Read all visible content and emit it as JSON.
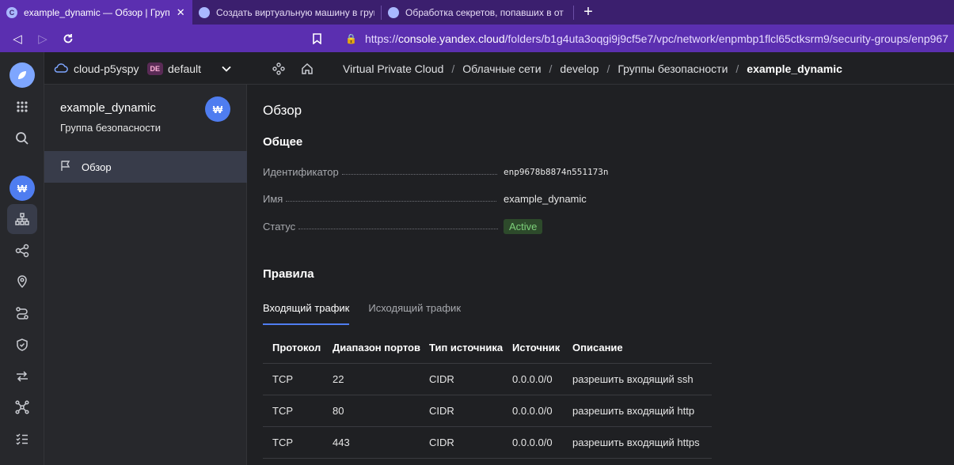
{
  "browser": {
    "tabs": [
      {
        "title": "example_dynamic — Обзор | Груп",
        "active": true
      },
      {
        "title": "Создать виртуальную машину в груп",
        "active": false
      },
      {
        "title": "Обработка секретов, попавших в от",
        "active": false
      }
    ],
    "url_prefix": "https://",
    "url_host": "console.yandex.cloud",
    "url_path": "/folders/b1g4uta3oqgi9j9cf5e7/vpc/network/enpmbp1flcl65ctksrm9/security-groups/enp967"
  },
  "header": {
    "cloud_name": "cloud-p5yspy",
    "folder_badge": "DE",
    "folder_name": "default",
    "breadcrumbs": [
      "Virtual Private Cloud",
      "Облачные сети",
      "develop",
      "Группы безопасности",
      "example_dynamic"
    ]
  },
  "panel": {
    "title": "example_dynamic",
    "subtitle": "Группа безопасности",
    "nav_item": "Обзор"
  },
  "main": {
    "title": "Обзор",
    "general_heading": "Общее",
    "props": {
      "id_label": "Идентификатор",
      "id_value": "enp9678b8874n551173n",
      "name_label": "Имя",
      "name_value": "example_dynamic",
      "status_label": "Статус",
      "status_value": "Active"
    },
    "rules_heading": "Правила",
    "tabs": [
      "Входящий трафик",
      "Исходящий трафик"
    ],
    "table": {
      "headers": [
        "Протокол",
        "Диапазон портов",
        "Тип источника",
        "Источник",
        "Описание"
      ],
      "rows": [
        [
          "TCP",
          "22",
          "CIDR",
          "0.0.0.0/0",
          "разрешить входящий ssh"
        ],
        [
          "TCP",
          "80",
          "CIDR",
          "0.0.0.0/0",
          "разрешить входящий http"
        ],
        [
          "TCP",
          "443",
          "CIDR",
          "0.0.0.0/0",
          "разрешить входящий https"
        ]
      ]
    }
  },
  "colors": {
    "accent": "#4f7df0",
    "browser_frame": "#5b2fb0",
    "status_active": "#7dd17a"
  }
}
